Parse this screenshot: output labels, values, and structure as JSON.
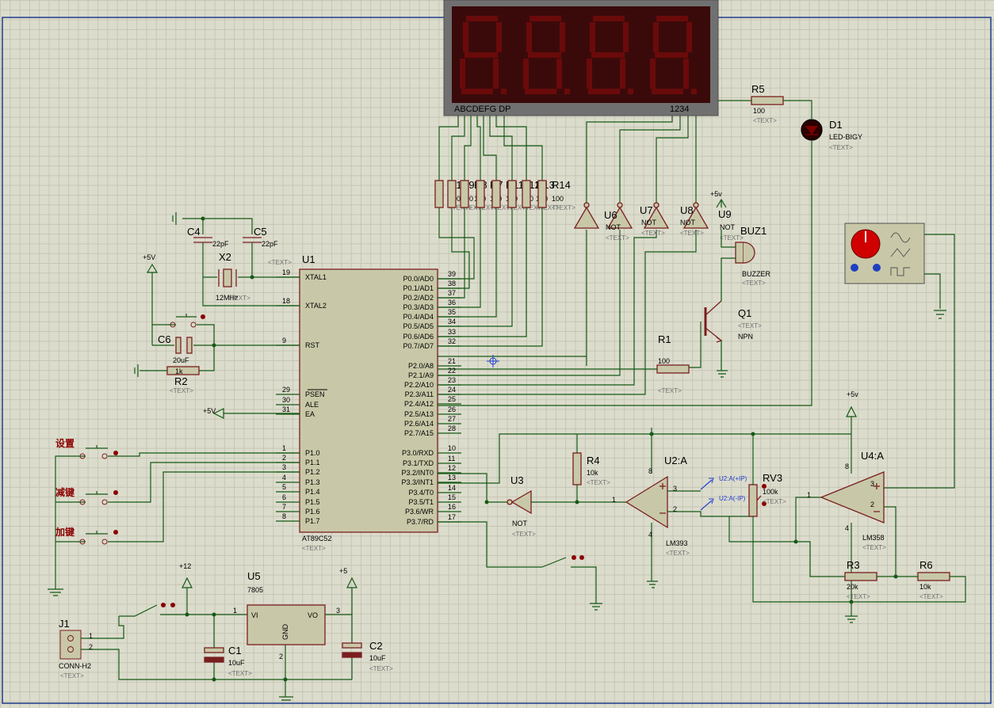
{
  "schematic": {
    "display": {
      "ref": "",
      "segments_label": "ABCDEFG DP",
      "digits_label": "1234"
    },
    "mcu": {
      "ref": "U1",
      "part": "AT89C52",
      "text": "<TEXT>",
      "left_pins": [
        {
          "num": "19",
          "name": "XTAL1"
        },
        {
          "num": "18",
          "name": "XTAL2"
        },
        {
          "num": "9",
          "name": "RST"
        },
        {
          "num": "29",
          "name": "PSEN"
        },
        {
          "num": "30",
          "name": "ALE"
        },
        {
          "num": "31",
          "name": "EA"
        },
        {
          "num": "1",
          "name": "P1.0"
        },
        {
          "num": "2",
          "name": "P1.1"
        },
        {
          "num": "3",
          "name": "P1.2"
        },
        {
          "num": "4",
          "name": "P1.3"
        },
        {
          "num": "5",
          "name": "P1.4"
        },
        {
          "num": "6",
          "name": "P1.5"
        },
        {
          "num": "7",
          "name": "P1.6"
        },
        {
          "num": "8",
          "name": "P1.7"
        }
      ],
      "right_pins": [
        {
          "num": "39",
          "name": "P0.0/AD0"
        },
        {
          "num": "38",
          "name": "P0.1/AD1"
        },
        {
          "num": "37",
          "name": "P0.2/AD2"
        },
        {
          "num": "36",
          "name": "P0.3/AD3"
        },
        {
          "num": "35",
          "name": "P0.4/AD4"
        },
        {
          "num": "34",
          "name": "P0.5/AD5"
        },
        {
          "num": "33",
          "name": "P0.6/AD6"
        },
        {
          "num": "32",
          "name": "P0.7/AD7"
        },
        {
          "num": "21",
          "name": "P2.0/A8"
        },
        {
          "num": "22",
          "name": "P2.1/A9"
        },
        {
          "num": "23",
          "name": "P2.2/A10"
        },
        {
          "num": "24",
          "name": "P2.3/A11"
        },
        {
          "num": "25",
          "name": "P2.4/A12"
        },
        {
          "num": "26",
          "name": "P2.5/A13"
        },
        {
          "num": "27",
          "name": "P2.6/A14"
        },
        {
          "num": "28",
          "name": "P2.7/A15"
        },
        {
          "num": "10",
          "name": "P3.0/RXD"
        },
        {
          "num": "11",
          "name": "P3.1/TXD"
        },
        {
          "num": "12",
          "name": "P3.2/INT0"
        },
        {
          "num": "13",
          "name": "P3.3/INT1"
        },
        {
          "num": "14",
          "name": "P3.4/T0"
        },
        {
          "num": "15",
          "name": "P3.5/T1"
        },
        {
          "num": "16",
          "name": "P3.6/WR"
        },
        {
          "num": "17",
          "name": "P3.7/RD"
        }
      ]
    },
    "seg_resistors": {
      "refs": [
        "R10",
        "R9",
        "R8",
        "R7",
        "R11",
        "R12",
        "R13",
        "R14"
      ],
      "value": "100",
      "text": "<TEXT>"
    },
    "components": {
      "r5": {
        "ref": "R5",
        "value": "100",
        "text": "<TEXT>"
      },
      "d1": {
        "ref": "D1",
        "value": "LED-BIGY",
        "text": "<TEXT>"
      },
      "u6": {
        "ref": "U6",
        "value": "NOT",
        "text": "<TEXT>"
      },
      "u7": {
        "ref": "U7",
        "value": "NOT",
        "text": "<TEXT>"
      },
      "u8": {
        "ref": "U8",
        "value": "NOT",
        "text": "<TEXT>"
      },
      "u9": {
        "ref": "U9",
        "value": "NOT",
        "text": "<TEXT>"
      },
      "buz1": {
        "ref": "BUZ1",
        "value": "BUZZER",
        "text": "<TEXT>"
      },
      "q1": {
        "ref": "Q1",
        "value": "NPN",
        "text": "<TEXT>"
      },
      "r1": {
        "ref": "R1",
        "value": "100",
        "text": "<TEXT>"
      },
      "c4": {
        "ref": "C4",
        "value": "22pF"
      },
      "c5": {
        "ref": "C5",
        "value": "22pF",
        "text": "<TEXT>"
      },
      "x2": {
        "ref": "X2",
        "value": "12MHz",
        "text": "<TEXT>"
      },
      "c6": {
        "ref": "C6",
        "value": "20uF"
      },
      "r2": {
        "ref": "R2",
        "value": "1k",
        "text": "<TEXT>"
      },
      "r4": {
        "ref": "R4",
        "value": "10k",
        "text": "<TEXT>"
      },
      "u3": {
        "ref": "U3",
        "value": "NOT",
        "text": "<TEXT>"
      },
      "u2a": {
        "ref": "U2:A",
        "value": "LM393",
        "text": "<TEXT>"
      },
      "rv3": {
        "ref": "RV3",
        "value": "100k",
        "text": "<TEXT>"
      },
      "u4a": {
        "ref": "U4:A",
        "value": "LM358",
        "text": "<TEXT>"
      },
      "r3": {
        "ref": "R3",
        "value": "20k",
        "text": "<TEXT>"
      },
      "r6": {
        "ref": "R6",
        "value": "10k",
        "text": "<TEXT>"
      },
      "u5": {
        "ref": "U5",
        "value": "7805",
        "pin_vi": "VI",
        "pin_vo": "VO",
        "pin_gnd": "GND"
      },
      "c1": {
        "ref": "C1",
        "value": "10uF",
        "text": "<TEXT>"
      },
      "c2": {
        "ref": "C2",
        "value": "10uF",
        "text": "<TEXT>"
      },
      "j1": {
        "ref": "J1",
        "value": "CONN-H2",
        "text": "<TEXT>"
      }
    },
    "buttons": {
      "set": "设置",
      "dec": "减键",
      "inc": "加键"
    },
    "power": {
      "p5v": "+5V",
      "p5v_lower": "+5v",
      "p12": "+12",
      "p5": "+5"
    },
    "probes": {
      "plus": "U2:A(+IP)",
      "minus": "U2:A(-IP)"
    },
    "op_pins": {
      "u2_in_plus": "3",
      "u2_in_minus": "2",
      "u2_out": "1",
      "u2_vcc": "8",
      "u2_gnd": "4",
      "u4_in_plus": "3",
      "u4_in_minus": "2",
      "u4_out": "1",
      "u4_vcc": "8",
      "u4_gnd": "4"
    },
    "misc_pins": {
      "j1_1": "1",
      "j1_2": "2",
      "u5_1": "1",
      "u5_2": "2",
      "u5_3": "3"
    }
  }
}
